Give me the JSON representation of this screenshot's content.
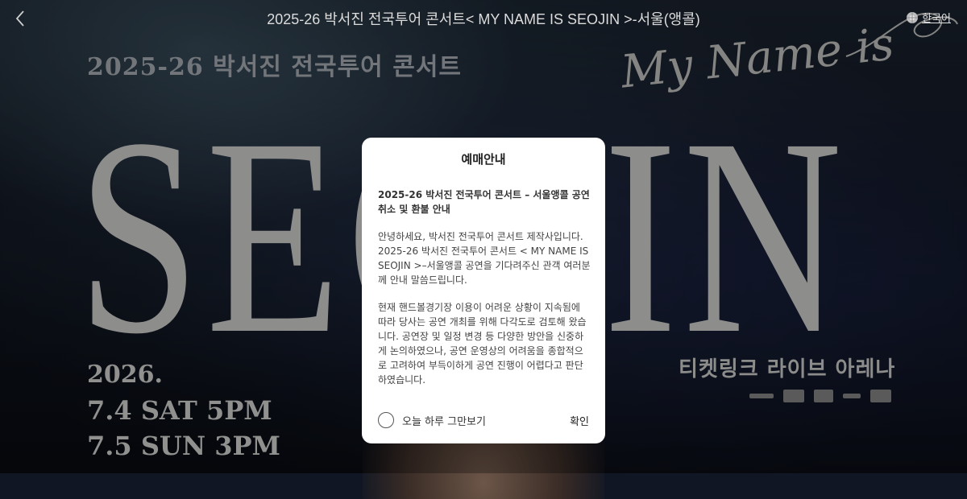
{
  "header": {
    "back_icon": "chevron-left-icon",
    "title": "2025-26 박서진 전국투어 콘서트< MY NAME IS SEOJIN >-서울(앵콜)",
    "language": "한국어",
    "language_icon": "globe-icon"
  },
  "poster": {
    "tour_text": "2025-26 박서진 전국투어 콘서트",
    "script_text": "My Name is",
    "big_text": "SEOJIN",
    "date_year": "2026.",
    "date_line1": "7.4 SAT 5PM",
    "date_line2": "7.5 SUN 3PM",
    "venue": "티켓링크 라이브 아레나"
  },
  "modal": {
    "title": "예매안내",
    "heading": "2025-26 박서진 전국투어 콘서트 – 서울앵콜 공연 취소 및 환불 안내",
    "paragraph1": "안녕하세요, 박서진 전국투어 콘서트 제작사입니다. 2025-26 박서진 전국투어 콘서트 < MY NAME IS SEOJIN >–서울앵콜 공연을 기다려주신 관객 여러분께 안내 말씀드립니다.",
    "paragraph2": "현재 핸드볼경기장 이용이 어려운 상황이 지속됨에 따라 당사는 공연 개최를 위해 다각도로 검토해 왔습니다. 공연장 및 일정 변경 등 다양한 방안을 신중하게 논의하였으나, 공연 운영상의 어려움을 종합적으로 고려하여 부득이하게 공연 진행이 어렵다고 판단하였습니다.",
    "dont_show_today": "오늘 하루 그만보기",
    "confirm": "확인"
  },
  "colors": {
    "modal_bg": "#ffffff",
    "text_dark": "#222222",
    "header_text": "#dcdcdc"
  }
}
